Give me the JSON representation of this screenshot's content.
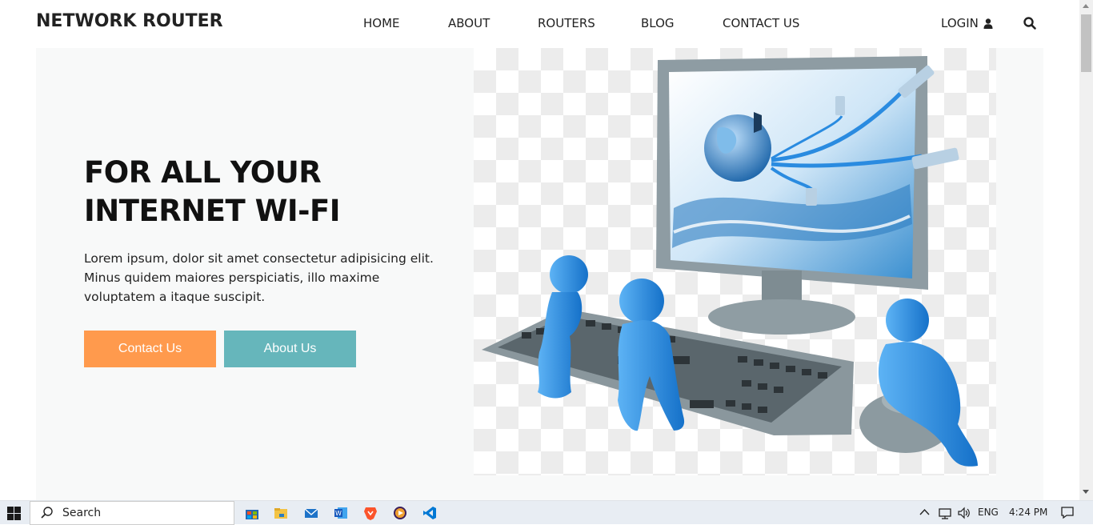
{
  "header": {
    "brand": "NETWORK ROUTER",
    "nav": [
      "HOME",
      "ABOUT",
      "ROUTERS",
      "BLOG",
      "CONTACT US"
    ],
    "login_label": "LOGIN"
  },
  "hero": {
    "title_line1": "FOR ALL YOUR",
    "title_line2": "INTERNET WI-FI",
    "body": "Lorem ipsum, dolor sit amet consectetur adipisicing elit. Minus quidem maiores perspiciatis, illo maxime voluptatem a itaque suscipit.",
    "contact_button": "Contact Us",
    "about_button": "About Us"
  },
  "taskbar": {
    "search_placeholder": "Search",
    "language": "ENG",
    "time": "4:24 PM"
  },
  "colors": {
    "contact_button": "#ff9a4d",
    "about_button": "#66b6bb",
    "hero_background": "#f8f9f9",
    "figure_blue": "#1a7fd4"
  }
}
